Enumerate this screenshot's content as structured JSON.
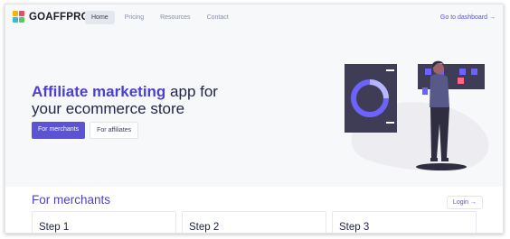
{
  "brand": {
    "name": "GOAFFPRO",
    "logo_colors": [
      "#f2b705",
      "#e74c6f",
      "#3fb9c9",
      "#5fc36a"
    ]
  },
  "nav": {
    "links": [
      {
        "label": "Home",
        "active": true
      },
      {
        "label": "Pricing",
        "active": false
      },
      {
        "label": "Resources",
        "active": false
      },
      {
        "label": "Contact",
        "active": false
      }
    ],
    "dashboard_label": "Go to dashboard →"
  },
  "hero": {
    "title_accent": "Affiliate marketing",
    "title_rest": " app for",
    "title_line2": "your ecommerce store",
    "primary_button": "For merchants",
    "secondary_button": "For affiliates"
  },
  "merchants": {
    "title": "For merchants",
    "login_label": "Login →",
    "steps": [
      "Step 1",
      "Step 2",
      "Step 3"
    ]
  },
  "colors": {
    "accent": "#5b52d6",
    "dark_panel": "#3f3d56",
    "figure_blue": "#6c63ff"
  }
}
